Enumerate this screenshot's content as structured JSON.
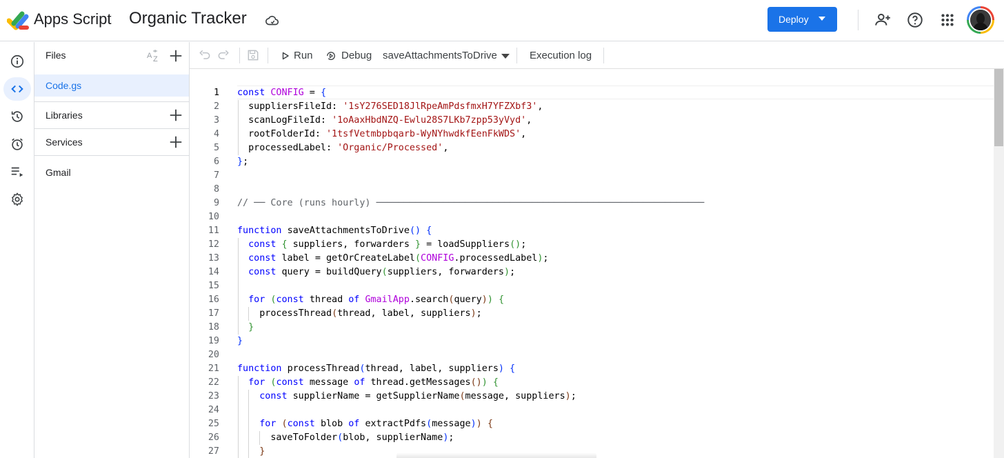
{
  "header": {
    "app_name": "Apps Script",
    "project_title": "Organic Tracker",
    "deploy_label": "Deploy",
    "icons": [
      "apps-script-logo",
      "cloud-icon",
      "add-person-icon",
      "help-icon",
      "apps-grid-icon",
      "account-avatar"
    ],
    "accent_color": "#1a73e8"
  },
  "rail": {
    "items": [
      "info-icon",
      "code-icon",
      "history-icon",
      "triggers-icon",
      "executions-icon",
      "settings-icon"
    ],
    "active": "code-icon"
  },
  "files_panel": {
    "title": "Files",
    "files": [
      {
        "name": "Code.gs",
        "selected": true
      }
    ],
    "libraries_label": "Libraries",
    "services_label": "Services",
    "services": [
      "Gmail"
    ]
  },
  "toolbar": {
    "run_label": "Run",
    "debug_label": "Debug",
    "function_name": "saveAttachmentsToDrive",
    "execution_log_label": "Execution log"
  },
  "editor": {
    "current_line": 1,
    "lines": [
      [
        {
          "t": "const ",
          "c": "kw"
        },
        {
          "t": "CONFIG",
          "c": "glob"
        },
        {
          "t": " = "
        },
        {
          "t": "{",
          "c": "br1"
        }
      ],
      [
        {
          "t": "  suppliersFileId: "
        },
        {
          "t": "'1sY276SED18JlRpeAmPdsfmxH7YFZXbf3'",
          "c": "str"
        },
        {
          "t": ","
        }
      ],
      [
        {
          "t": "  scanLogFileId: "
        },
        {
          "t": "'1oAaxHbdNZQ-Ewlu28S7LKb7zpp53yVyd'",
          "c": "str"
        },
        {
          "t": ","
        }
      ],
      [
        {
          "t": "  rootFolderId: "
        },
        {
          "t": "'1tsfVetmbpbqarb-WyNYhwdkfEenFkWDS'",
          "c": "str"
        },
        {
          "t": ","
        }
      ],
      [
        {
          "t": "  processedLabel: "
        },
        {
          "t": "'Organic/Processed'",
          "c": "str"
        },
        {
          "t": ","
        }
      ],
      [
        {
          "t": "}",
          "c": "br1"
        },
        {
          "t": ";"
        }
      ],
      [],
      [],
      [
        {
          "t": "// ── Core (runs hourly) ───────────────────────────────────────────────────────────",
          "c": "cmt"
        }
      ],
      [],
      [
        {
          "t": "function ",
          "c": "kw"
        },
        {
          "t": "saveAttachmentsToDrive"
        },
        {
          "t": "()",
          "c": "br1"
        },
        {
          "t": " "
        },
        {
          "t": "{",
          "c": "br1"
        }
      ],
      [
        {
          "t": "  const ",
          "c": "kw"
        },
        {
          "t": "{",
          "c": "br2"
        },
        {
          "t": " suppliers, forwarders "
        },
        {
          "t": "}",
          "c": "br2"
        },
        {
          "t": " = loadSuppliers"
        },
        {
          "t": "()",
          "c": "br2"
        },
        {
          "t": ";"
        }
      ],
      [
        {
          "t": "  const ",
          "c": "kw"
        },
        {
          "t": "label = getOrCreateLabel"
        },
        {
          "t": "(",
          "c": "br2"
        },
        {
          "t": "CONFIG",
          "c": "glob"
        },
        {
          "t": ".processedLabel"
        },
        {
          "t": ")",
          "c": "br2"
        },
        {
          "t": ";"
        }
      ],
      [
        {
          "t": "  const ",
          "c": "kw"
        },
        {
          "t": "query = buildQuery"
        },
        {
          "t": "(",
          "c": "br2"
        },
        {
          "t": "suppliers, forwarders"
        },
        {
          "t": ")",
          "c": "br2"
        },
        {
          "t": ";"
        }
      ],
      [],
      [
        {
          "t": "  for ",
          "c": "kw"
        },
        {
          "t": "(",
          "c": "br2"
        },
        {
          "t": "const ",
          "c": "kw"
        },
        {
          "t": "thread "
        },
        {
          "t": "of ",
          "c": "kw"
        },
        {
          "t": "GmailApp",
          "c": "glob"
        },
        {
          "t": ".search"
        },
        {
          "t": "(",
          "c": "br3"
        },
        {
          "t": "query"
        },
        {
          "t": ")",
          "c": "br3"
        },
        {
          "t": ")",
          "c": "br2"
        },
        {
          "t": " "
        },
        {
          "t": "{",
          "c": "br2"
        }
      ],
      [
        {
          "t": "    processThread"
        },
        {
          "t": "(",
          "c": "br3"
        },
        {
          "t": "thread, label, suppliers"
        },
        {
          "t": ")",
          "c": "br3"
        },
        {
          "t": ";"
        }
      ],
      [
        {
          "t": "  }",
          "c": "br2"
        }
      ],
      [
        {
          "t": "}",
          "c": "br1"
        }
      ],
      [],
      [
        {
          "t": "function ",
          "c": "kw"
        },
        {
          "t": "processThread"
        },
        {
          "t": "(",
          "c": "br1"
        },
        {
          "t": "thread, label, suppliers"
        },
        {
          "t": ")",
          "c": "br1"
        },
        {
          "t": " "
        },
        {
          "t": "{",
          "c": "br1"
        }
      ],
      [
        {
          "t": "  for ",
          "c": "kw"
        },
        {
          "t": "(",
          "c": "br2"
        },
        {
          "t": "const ",
          "c": "kw"
        },
        {
          "t": "message "
        },
        {
          "t": "of ",
          "c": "kw"
        },
        {
          "t": "thread.getMessages"
        },
        {
          "t": "()",
          "c": "br3"
        },
        {
          "t": ")",
          "c": "br2"
        },
        {
          "t": " "
        },
        {
          "t": "{",
          "c": "br2"
        }
      ],
      [
        {
          "t": "    const ",
          "c": "kw"
        },
        {
          "t": "supplierName = getSupplierName"
        },
        {
          "t": "(",
          "c": "br3"
        },
        {
          "t": "message, suppliers"
        },
        {
          "t": ")",
          "c": "br3"
        },
        {
          "t": ";"
        }
      ],
      [],
      [
        {
          "t": "    for ",
          "c": "kw"
        },
        {
          "t": "(",
          "c": "br3"
        },
        {
          "t": "const ",
          "c": "kw"
        },
        {
          "t": "blob "
        },
        {
          "t": "of ",
          "c": "kw"
        },
        {
          "t": "extractPdfs"
        },
        {
          "t": "(",
          "c": "br1"
        },
        {
          "t": "message"
        },
        {
          "t": ")",
          "c": "br1"
        },
        {
          "t": ")",
          "c": "br3"
        },
        {
          "t": " "
        },
        {
          "t": "{",
          "c": "br3"
        }
      ],
      [
        {
          "t": "      saveToFolder"
        },
        {
          "t": "(",
          "c": "br1"
        },
        {
          "t": "blob, supplierName"
        },
        {
          "t": ")",
          "c": "br1"
        },
        {
          "t": ";"
        }
      ],
      [
        {
          "t": "    }",
          "c": "br3"
        }
      ]
    ]
  }
}
